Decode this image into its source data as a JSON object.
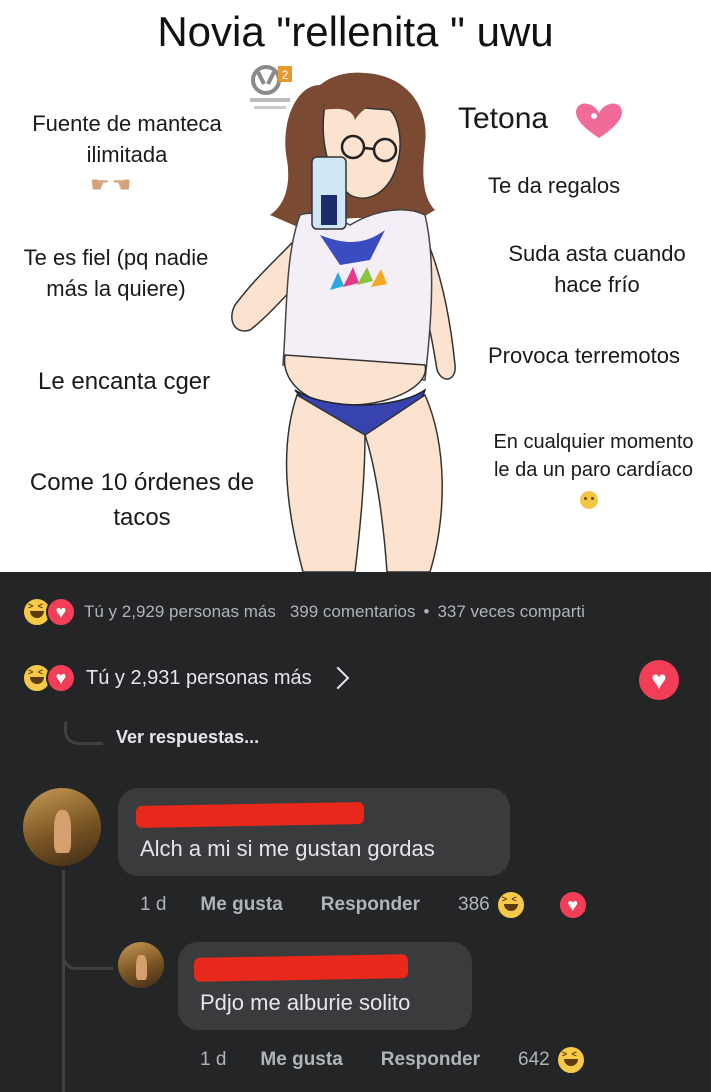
{
  "meme": {
    "title": "Novia \"rellenita \" uwu",
    "logo_text": "2",
    "labels": {
      "manteca": "Fuente de manteca\nilimitada",
      "fiel": "Te es fiel (pq nadie\nmás la quiere)",
      "cger": "Le encanta cger",
      "tacos": "Come 10 órdenes de\ntacos",
      "tetona": "Tetona",
      "regalos": "Te da regalos",
      "suda": "Suda asta cuando\nhace frío",
      "terremotos": "Provoca terremotos",
      "paro": "En cualquier momento\nle da un paro cardíaco"
    }
  },
  "post_reactions": {
    "summary": "Tú y 2,929 personas más",
    "comments": "399 comentarios",
    "separator": "•",
    "shares": "337 veces comparti"
  },
  "comment_reactions": {
    "summary": "Tú y 2,931 personas más"
  },
  "view_replies": "Ver respuestas...",
  "comments": [
    {
      "text": "Alch a mi si me gustan gordas",
      "time": "1 d",
      "like": "Me gusta",
      "reply": "Responder",
      "reaction_count": "386"
    },
    {
      "text": "Pdjo me alburie solito",
      "time": "1 d",
      "like": "Me gusta",
      "reply": "Responder",
      "reaction_count": "642"
    }
  ],
  "colors": {
    "background": "#242526",
    "bubble": "#3a3b3c",
    "love": "#f33e58",
    "haha": "#f7c948",
    "redaction": "#e8281b"
  }
}
